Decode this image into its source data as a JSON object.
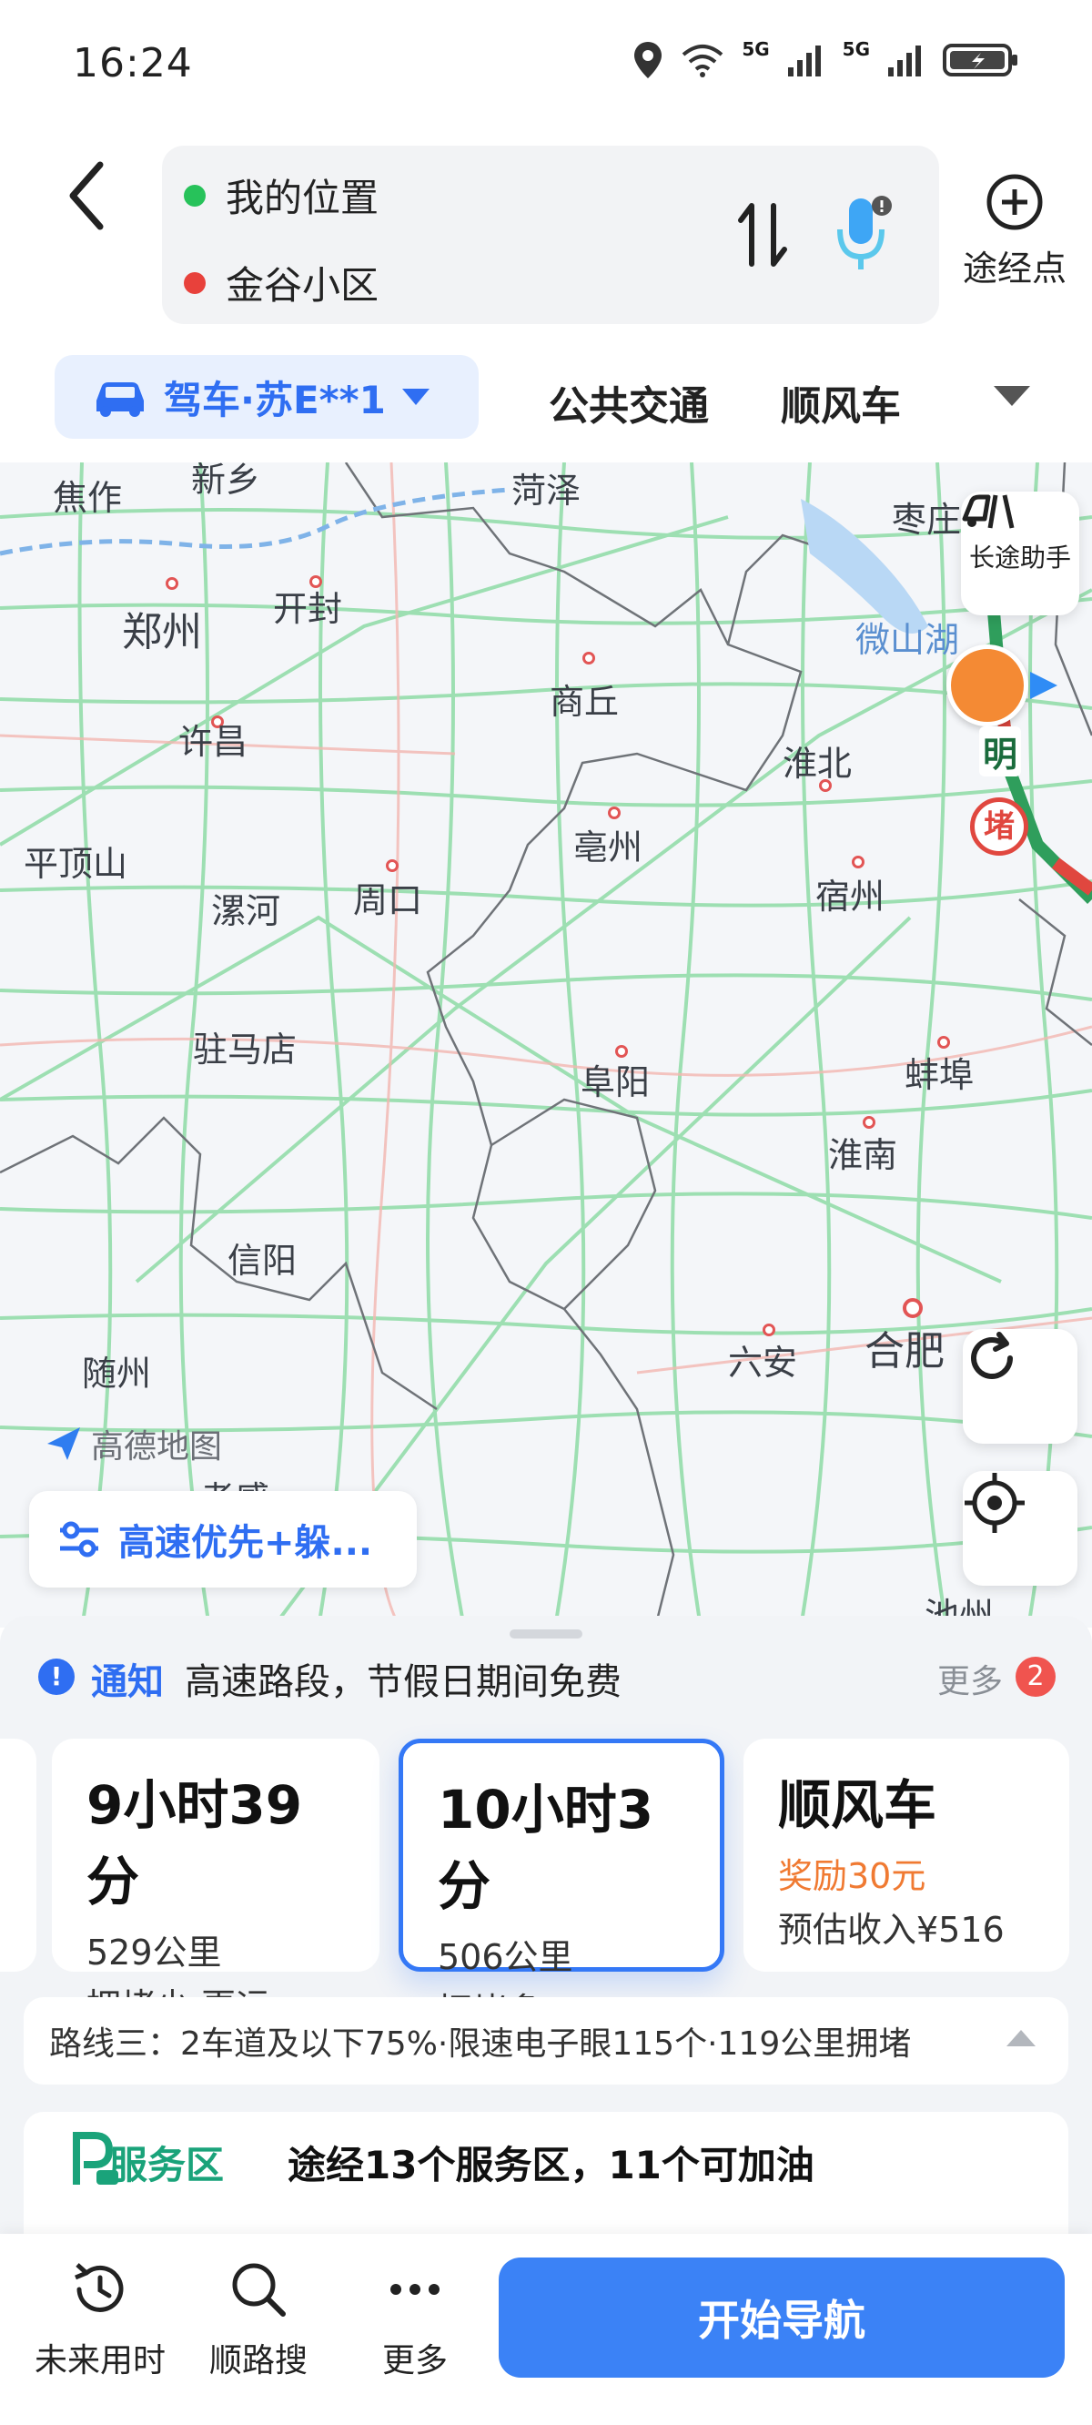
{
  "status": {
    "time": "16:24",
    "signal1": "5G",
    "signal2": "5G"
  },
  "route": {
    "origin": "我的位置",
    "destination": "金谷小区",
    "via_label": "途经点"
  },
  "modes": {
    "drive": "驾车·苏E**1",
    "transit": "公共交通",
    "carpool": "顺风车"
  },
  "map": {
    "cities": [
      {
        "name": "焦作"
      },
      {
        "name": "新乡"
      },
      {
        "name": "菏泽"
      },
      {
        "name": "枣庄"
      },
      {
        "name": "郑州"
      },
      {
        "name": "开封"
      },
      {
        "name": "微山湖"
      },
      {
        "name": "商丘"
      },
      {
        "name": "许昌"
      },
      {
        "name": "淮北"
      },
      {
        "name": "平顶山"
      },
      {
        "name": "亳州"
      },
      {
        "name": "漯河"
      },
      {
        "name": "周口"
      },
      {
        "name": "宿州"
      },
      {
        "name": "驻马店"
      },
      {
        "name": "阜阳"
      },
      {
        "name": "蚌埠"
      },
      {
        "name": "淮南"
      },
      {
        "name": "信阳"
      },
      {
        "name": "六安"
      },
      {
        "name": "合肥"
      },
      {
        "name": "随州"
      },
      {
        "name": "孝感"
      },
      {
        "name": "池州"
      }
    ],
    "road_label": "明",
    "congestion_label": "堵",
    "assistant_label": "长途助手",
    "logo_text": "高德地图",
    "preference_chip": "高速优先+躲..."
  },
  "notice": {
    "title": "通知",
    "text": "高速路段，节假日期间免费",
    "more": "更多",
    "badge": "2"
  },
  "route_cards": [
    {
      "time": "9小时39分",
      "distance": "529公里",
      "desc": "拥堵少·更远"
    },
    {
      "time": "10小时3分",
      "distance": "506公里",
      "desc": "拥堵多"
    },
    {
      "time": "顺风车",
      "reward": "奖励30元",
      "income": "预估收入¥516"
    }
  ],
  "route_info": "路线三：2车道及以下75%·限速电子眼115个·119公里拥堵",
  "service": {
    "label": "服务区",
    "text": "途经13个服务区，11个可加油"
  },
  "bottom": {
    "future": "未来用时",
    "search": "顺路搜",
    "more": "更多",
    "navigate": "开始导航"
  },
  "colors": {
    "accent": "#2f6ef2",
    "road": "#7fd39a",
    "congestion": "#e0473f",
    "service_green": "#1aa37a"
  }
}
